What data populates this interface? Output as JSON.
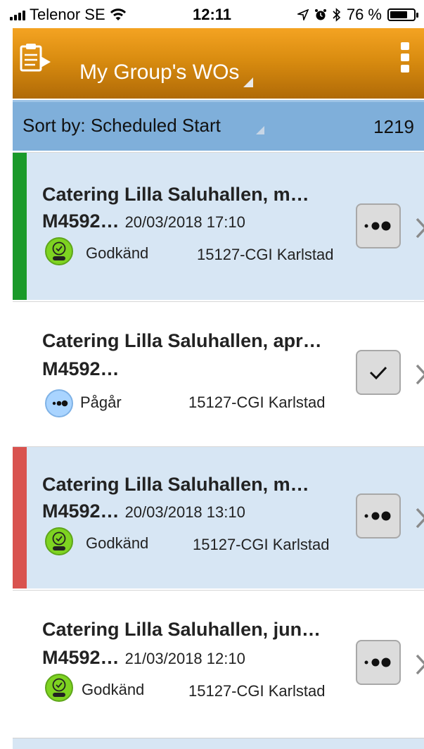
{
  "status_bar": {
    "carrier": "Telenor SE",
    "time": "12:11",
    "battery": "76 %",
    "battery_level": 0.76
  },
  "header": {
    "title": "My Group's WOs",
    "icon": "clipboard-play-icon",
    "menu_icon": "kebab-menu-icon"
  },
  "sort": {
    "label": "Sort by: Scheduled Start",
    "count": "1219"
  },
  "colors": {
    "header_top": "#f4a322",
    "header_bottom": "#b06a07",
    "sort_bar": "#7fafda",
    "highlight_row": "#d7e6f4",
    "stripe_green": "#1a9a2a",
    "stripe_red": "#d9534f",
    "approved": "#7ed321",
    "in_progress": "#a9d4ff"
  },
  "work_orders": [
    {
      "title": "Catering Lilla Saluhallen, m…",
      "id": "M4592…",
      "date": "20/03/2018 17:10",
      "status": "Godkänd",
      "status_icon": "approved-check-icon",
      "group": "15127-CGI Karlstad",
      "action_icon": "more-dots-icon",
      "stripe": "green"
    },
    {
      "title": "Catering Lilla Saluhallen, apr…",
      "id": "M4592…",
      "date": "",
      "status": "Pågår",
      "status_icon": "in-progress-dots-icon",
      "group": "15127-CGI Karlstad",
      "action_icon": "checkmark-icon",
      "stripe": "none"
    },
    {
      "title": "Catering Lilla Saluhallen, m…",
      "id": "M4592…",
      "date": "20/03/2018 13:10",
      "status": "Godkänd",
      "status_icon": "approved-check-icon",
      "group": "15127-CGI Karlstad",
      "action_icon": "more-dots-icon",
      "stripe": "red"
    },
    {
      "title": "Catering Lilla Saluhallen, jun…",
      "id": "M4592…",
      "date": "21/03/2018 12:10",
      "status": "Godkänd",
      "status_icon": "approved-check-icon",
      "group": "15127-CGI Karlstad",
      "action_icon": "more-dots-icon",
      "stripe": "none"
    }
  ]
}
